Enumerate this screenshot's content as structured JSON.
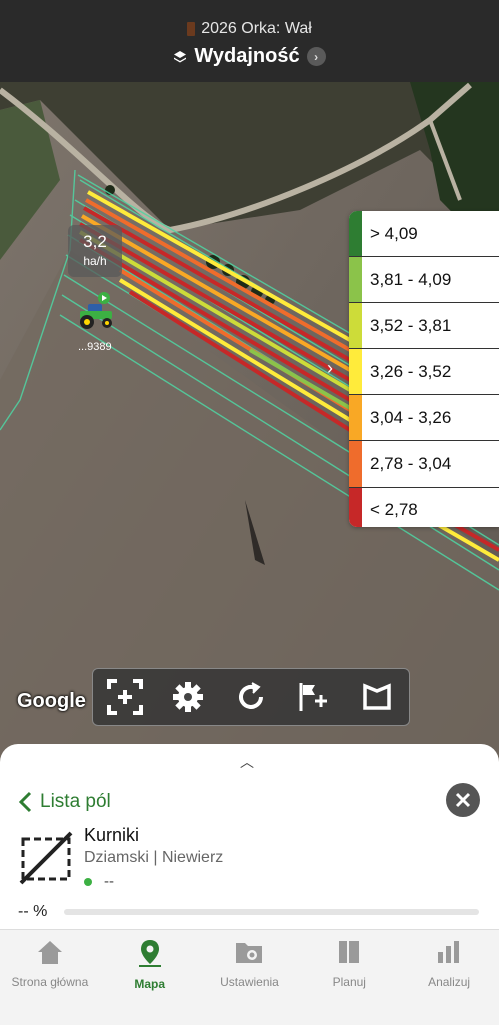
{
  "header": {
    "season_operation": "2026 Orka: Wał",
    "layer_title": "Wydajność",
    "season_color": "#6b3a1e"
  },
  "legend": {
    "items": [
      {
        "label": "> 4,09",
        "color": "#2e7d32"
      },
      {
        "label": "3,81 - 4,09",
        "color": "#8bc34a"
      },
      {
        "label": "3,52 - 3,81",
        "color": "#cddc39"
      },
      {
        "label": "3,26 - 3,52",
        "color": "#ffeb3b"
      },
      {
        "label": "3,04 - 3,26",
        "color": "#f9a825"
      },
      {
        "label": "2,78 - 3,04",
        "color": "#ef6c2c"
      },
      {
        "label": "< 2,78",
        "color": "#c62828"
      }
    ]
  },
  "map": {
    "speed_value": "3,2",
    "speed_unit": "ha/h",
    "machine_id": "...9389",
    "attribution": "Google",
    "toolbar": [
      "fit-bounds-icon",
      "gear-icon",
      "refresh-icon",
      "add-flag-icon",
      "field-boundary-icon"
    ]
  },
  "sheet": {
    "back_label": "Lista pól",
    "field_name": "Kurniki",
    "field_location": "Dziamski | Niewierz",
    "status_text": "--",
    "progress_text": "-- %",
    "progress_fraction": 0
  },
  "nav": {
    "items": [
      {
        "label": "Strona główna",
        "icon": "home-icon",
        "active": false
      },
      {
        "label": "Mapa",
        "icon": "map-pin-icon",
        "active": true
      },
      {
        "label": "Ustawienia",
        "icon": "settings-folder-icon",
        "active": false
      },
      {
        "label": "Planuj",
        "icon": "plan-icon",
        "active": false
      },
      {
        "label": "Analizuj",
        "icon": "analyze-icon",
        "active": false
      }
    ]
  }
}
